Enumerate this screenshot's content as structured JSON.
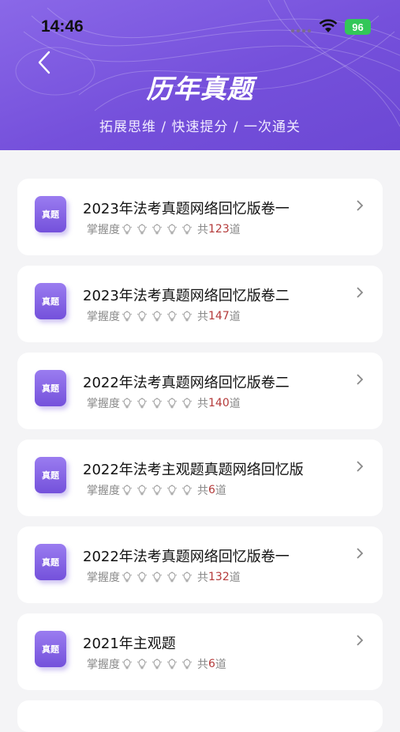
{
  "status_bar": {
    "time": "14:46",
    "battery": "96"
  },
  "header": {
    "title": "历年真题",
    "subtitle": "拓展思维 / 快速提分 / 一次通关"
  },
  "items": [
    {
      "badge": "真题",
      "name": "2023年法考真题网络回忆版卷一",
      "mastery_label": "掌握度",
      "prefix": "共",
      "count": "123",
      "unit": "道"
    },
    {
      "badge": "真题",
      "name": "2023年法考真题网络回忆版卷二",
      "mastery_label": "掌握度",
      "prefix": "共",
      "count": "147",
      "unit": "道"
    },
    {
      "badge": "真题",
      "name": "2022年法考真题网络回忆版卷二",
      "mastery_label": "掌握度",
      "prefix": "共",
      "count": "140",
      "unit": "道"
    },
    {
      "badge": "真题",
      "name": "2022年法考主观题真题网络回忆版",
      "mastery_label": "掌握度",
      "prefix": "共",
      "count": "6",
      "unit": "道"
    },
    {
      "badge": "真题",
      "name": "2022年法考真题网络回忆版卷一",
      "mastery_label": "掌握度",
      "prefix": "共",
      "count": "132",
      "unit": "道"
    },
    {
      "badge": "真题",
      "name": "2021年主观题",
      "mastery_label": "掌握度",
      "prefix": "共",
      "count": "6",
      "unit": "道"
    }
  ],
  "mastery_level": 0,
  "icons": {
    "back": "back-arrow-icon",
    "chevron": "chevron-right-icon",
    "mastery": "lightbulb-icon",
    "wifi": "wifi-icon",
    "battery": "battery-icon"
  },
  "colors": {
    "header": "#7550db",
    "count": "#b43a3a"
  }
}
